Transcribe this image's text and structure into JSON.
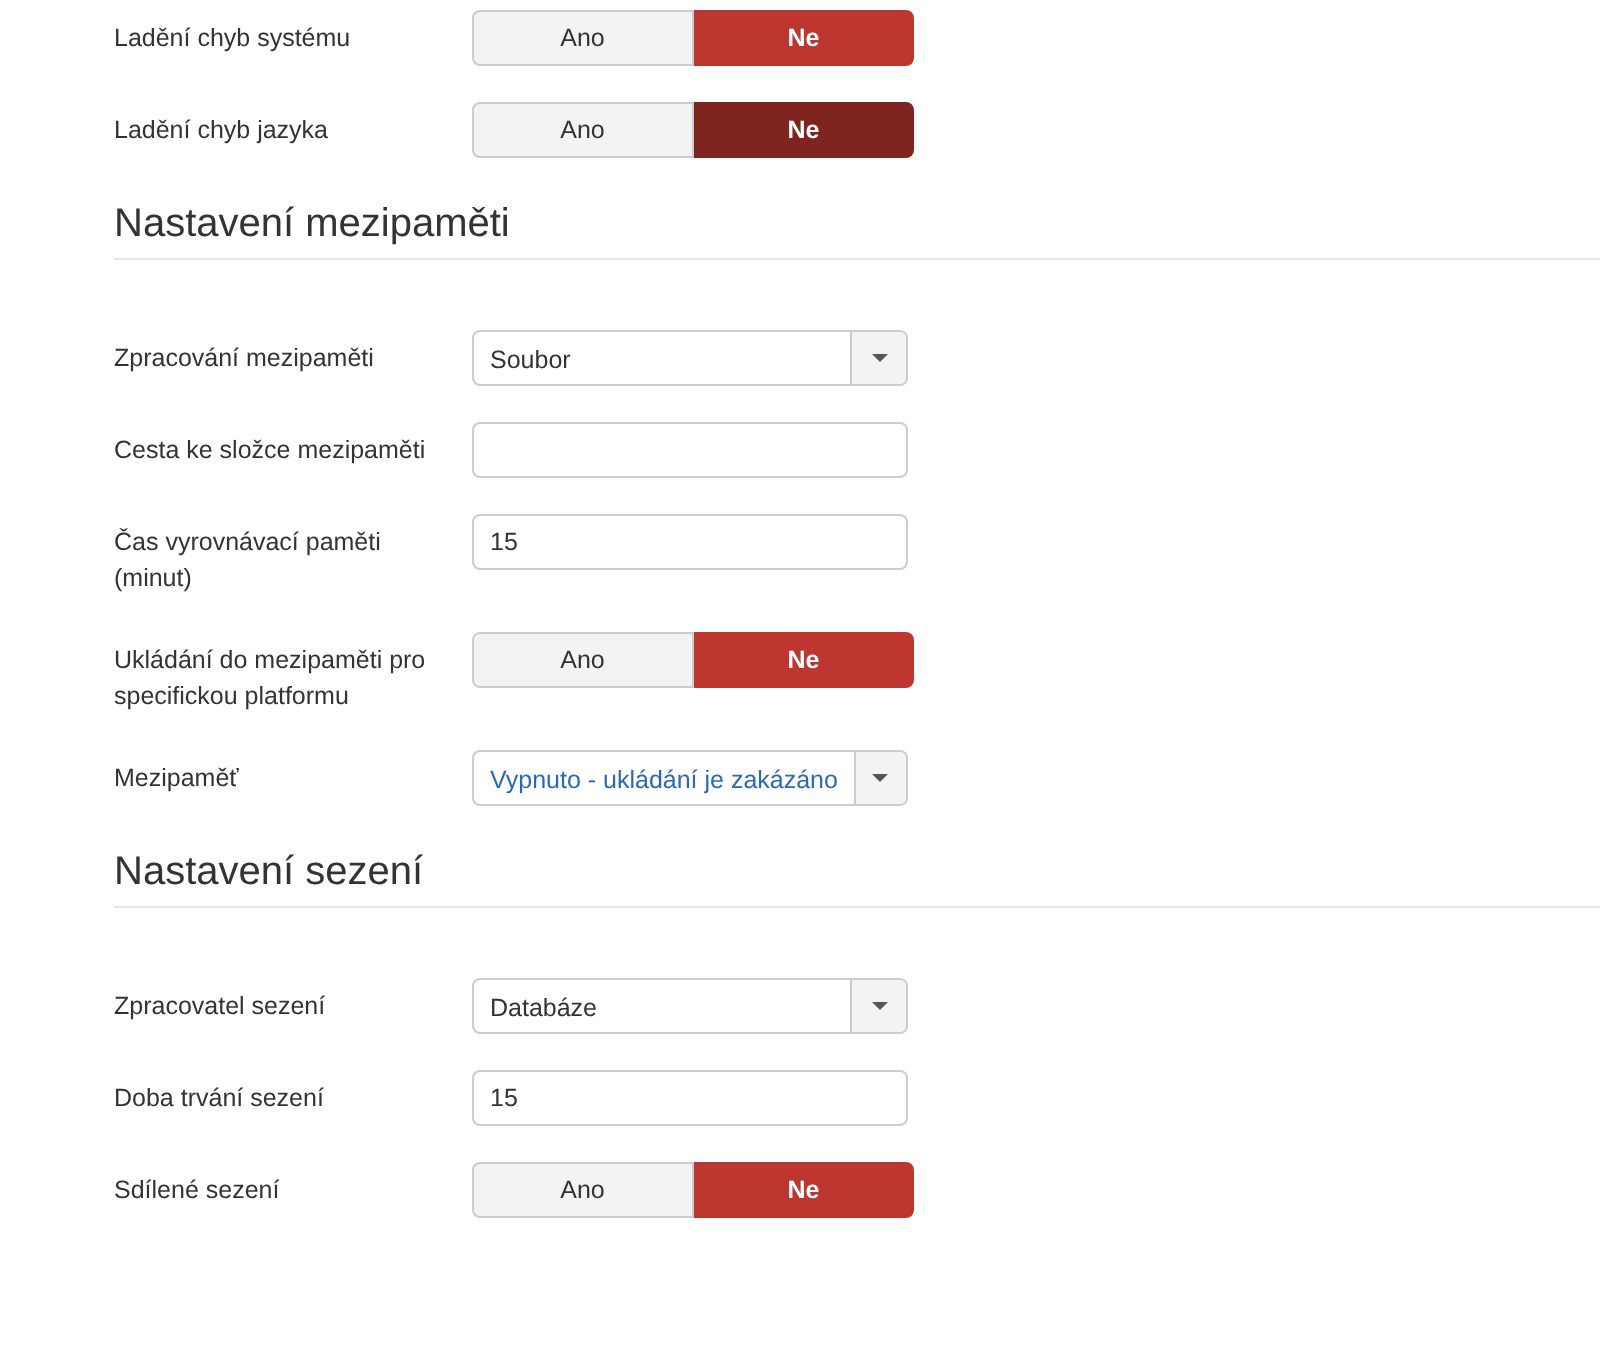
{
  "sections": [
    {
      "fields": [
        {
          "kind": "toggle",
          "label": "Ladění chyb systému",
          "focused": false,
          "options": [
            {
              "label": "Ano",
              "selected": false
            },
            {
              "label": "Ne",
              "selected": true
            }
          ]
        },
        {
          "kind": "toggle",
          "label": "Ladění chyb jazyka",
          "focused": true,
          "options": [
            {
              "label": "Ano",
              "selected": false
            },
            {
              "label": "Ne",
              "selected": true
            }
          ]
        }
      ]
    },
    {
      "heading": "Nastavení mezipaměti",
      "fields": [
        {
          "kind": "select",
          "label": "Zpracování mezipaměti",
          "value": "Soubor",
          "highlighted": false
        },
        {
          "kind": "text",
          "label": "Cesta ke složce mezipaměti"
        },
        {
          "kind": "text",
          "label": "Čas vyrovnávací paměti (minut)",
          "value": "15"
        },
        {
          "kind": "toggle",
          "label": "Ukládání do mezipaměti pro specifickou platformu",
          "focused": false,
          "options": [
            {
              "label": "Ano",
              "selected": false
            },
            {
              "label": "Ne",
              "selected": true
            }
          ]
        },
        {
          "kind": "select",
          "label": "Mezipaměť",
          "value": "Vypnuto - ukládání je zakázáno",
          "highlighted": true
        }
      ]
    },
    {
      "heading": "Nastavení sezení",
      "fields": [
        {
          "kind": "select",
          "label": "Zpracovatel sezení",
          "value": "Databáze",
          "highlighted": false
        },
        {
          "kind": "text",
          "label": "Doba trvání sezení",
          "value": "15"
        },
        {
          "kind": "toggle",
          "label": "Sdílené sezení",
          "focused": false,
          "options": [
            {
              "label": "Ano",
              "selected": false
            },
            {
              "label": "Ne",
              "selected": true
            }
          ]
        }
      ]
    }
  ]
}
